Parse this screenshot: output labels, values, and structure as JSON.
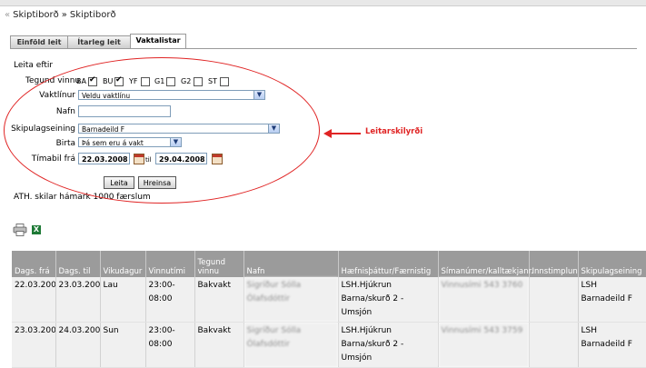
{
  "breadcrumb": {
    "lead": "«",
    "items": [
      "Skiptiborð",
      "Skiptiborð"
    ],
    "separator": "»"
  },
  "tabs": [
    {
      "label": "Einföld leit",
      "active": false
    },
    {
      "label": "Ítarleg leit",
      "active": false
    },
    {
      "label": "Vaktalistar",
      "active": true
    }
  ],
  "form": {
    "section_label": "Leita eftir",
    "tegund_label": "Tegund vinnu",
    "work_types": [
      {
        "label": "BA",
        "checked": true
      },
      {
        "label": "BU",
        "checked": true
      },
      {
        "label": "YF",
        "checked": false
      },
      {
        "label": "G1",
        "checked": false
      },
      {
        "label": "G2",
        "checked": false
      },
      {
        "label": "ST",
        "checked": false
      }
    ],
    "vaktlinur_label": "Vaktlínur",
    "vaktlinur_value": "Veldu vaktlínu",
    "nafn_label": "Nafn",
    "nafn_value": "",
    "skipulag_label": "Skipulagseining",
    "skipulag_value": "Barnadeild F",
    "birta_label": "Birta",
    "birta_value": "Þá sem eru á vakt",
    "timabil_label": "Tímabil frá",
    "date_from": "22.03.2008",
    "til_label": "til",
    "date_to": "29.04.2008",
    "search_button": "Leita",
    "clear_button": "Hreinsa",
    "note": "ATH. skilar hámark 1000 færslum"
  },
  "annotation": {
    "text": "Leitarskilyrði",
    "color": "#e02424"
  },
  "table": {
    "headers": [
      "Dags. frá",
      "Dags. til",
      "Vikudagur",
      "Vinnutími",
      "Tegund vinnu",
      "Nafn",
      "Hæfnisþáttur/Færnistig",
      "Símanúmer/kalltækjanr.",
      "Innstimplun",
      "Skipulagseining"
    ],
    "rows": [
      {
        "from": "22.03.2008",
        "to": "23.03.2008",
        "day": "Lau",
        "time": "23:00-08:00",
        "type": "Bakvakt",
        "name": "Sigríður Sólla Ólafsdóttir",
        "skill": "LSH.Hjúkrun Barna/skurð 2 - Umsjón",
        "phone": "Vinnusími 543 3760",
        "stamp": "",
        "unit": "LSH Barnadeild F"
      },
      {
        "from": "23.03.2008",
        "to": "24.03.2008",
        "day": "Sun",
        "time": "23:00-08:00",
        "type": "Bakvakt",
        "name": "Sigríður Sólla Ólafsdóttir",
        "skill": "LSH.Hjúkrun Barna/skurð 2 - Umsjón",
        "phone": "Vinnusími 543 3759",
        "stamp": "",
        "unit": "LSH Barnadeild F"
      }
    ]
  },
  "colors": {
    "table_header_bg": "#9b9b9b",
    "table_row_bg": "#f0f0f0",
    "annotation": "#e02424"
  }
}
